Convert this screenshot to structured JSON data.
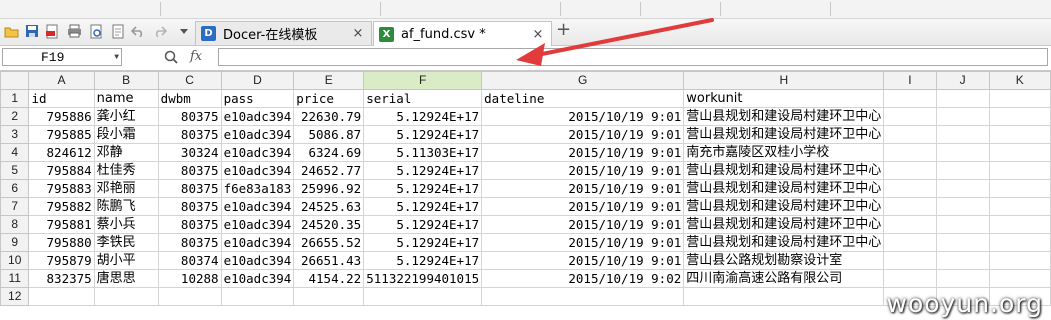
{
  "tabs": [
    {
      "label": "Docer-在线模板",
      "close": "×",
      "icon": "docer-icon",
      "color": "#2b6cc4"
    },
    {
      "label": "af_fund.csv *",
      "close": "×",
      "icon": "spreadsheet-icon",
      "color": "#2e8b3c"
    }
  ],
  "new_tab": "+",
  "formula_bar": {
    "cell_ref": "F19",
    "fx": "fx",
    "value": ""
  },
  "columns": [
    "A",
    "B",
    "C",
    "D",
    "E",
    "F",
    "G",
    "H",
    "I",
    "J",
    "K"
  ],
  "selected_column": "F",
  "rows": [
    {
      "n": "1",
      "cells": [
        "id",
        "name",
        "dwbm",
        "pass",
        "price",
        "serial",
        "dateline",
        "workunit"
      ]
    },
    {
      "n": "2",
      "cells": [
        "795886",
        "龚小红",
        "80375",
        "e10adc394",
        "22630.79",
        "5.12924E+17",
        "2015/10/19  9:01",
        "营山县规划和建设局村建环卫中心"
      ]
    },
    {
      "n": "3",
      "cells": [
        "795885",
        "段小霜",
        "80375",
        "e10adc394",
        "5086.87",
        "5.12924E+17",
        "2015/10/19  9:01",
        "营山县规划和建设局村建环卫中心"
      ]
    },
    {
      "n": "4",
      "cells": [
        "824612",
        "邓静",
        "30324",
        "e10adc394",
        "6324.69",
        "5.11303E+17",
        "2015/10/19  9:01",
        "南充市嘉陵区双桂小学校"
      ]
    },
    {
      "n": "5",
      "cells": [
        "795884",
        "杜佳秀",
        "80375",
        "e10adc394",
        "24652.77",
        "5.12924E+17",
        "2015/10/19  9:01",
        "营山县规划和建设局村建环卫中心"
      ]
    },
    {
      "n": "6",
      "cells": [
        "795883",
        "邓艳丽",
        "80375",
        "f6e83a183",
        "25996.92",
        "5.12924E+17",
        "2015/10/19  9:01",
        "营山县规划和建设局村建环卫中心"
      ]
    },
    {
      "n": "7",
      "cells": [
        "795882",
        "陈鹏飞",
        "80375",
        "e10adc394",
        "24525.63",
        "5.12924E+17",
        "2015/10/19  9:01",
        "营山县规划和建设局村建环卫中心"
      ]
    },
    {
      "n": "8",
      "cells": [
        "795881",
        "蔡小兵",
        "80375",
        "e10adc394",
        "24520.35",
        "5.12924E+17",
        "2015/10/19  9:01",
        "营山县规划和建设局村建环卫中心"
      ]
    },
    {
      "n": "9",
      "cells": [
        "795880",
        "李铁民",
        "80375",
        "e10adc394",
        "26655.52",
        "5.12924E+17",
        "2015/10/19  9:01",
        "营山县规划和建设局村建环卫中心"
      ]
    },
    {
      "n": "10",
      "cells": [
        "795879",
        "胡小平",
        "80374",
        "e10adc394",
        "26651.43",
        "5.12924E+17",
        "2015/10/19  9:01",
        "营山县公路规划勘察设计室"
      ]
    },
    {
      "n": "11",
      "cells": [
        "832375",
        "唐思思",
        "10288",
        "e10adc394",
        "4154.22",
        "511322199401015",
        "2015/10/19  9:02",
        "四川南渝高速公路有限公司"
      ]
    },
    {
      "n": "12",
      "cells": [
        "",
        "",
        "",
        "",
        "",
        "",
        "",
        ""
      ]
    }
  ],
  "arrow_color": "#e23b3b",
  "watermark": "wooyun.org"
}
